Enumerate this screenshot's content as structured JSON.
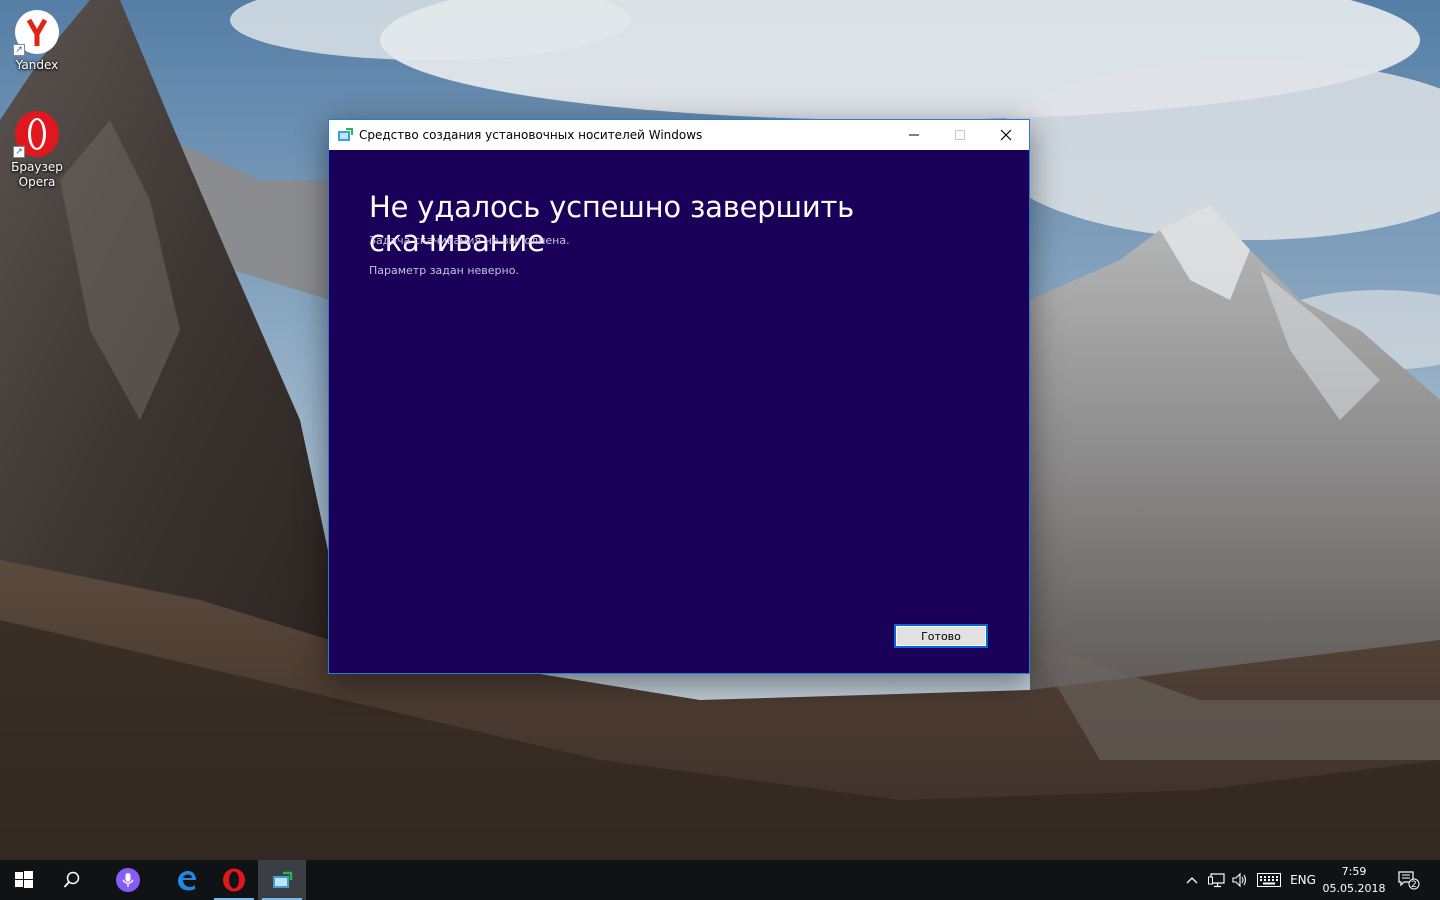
{
  "desktop": {
    "icons": [
      {
        "label": "Yandex",
        "icon": "yandex-browser-icon"
      },
      {
        "label": "Браузер Opera",
        "icon": "opera-browser-icon"
      }
    ]
  },
  "window": {
    "title": "Средство создания установочных носителей Windows",
    "heading": "Не удалось успешно завершить скачивание",
    "message_1": "Задача скачивания не выполнена.",
    "message_2": "Параметр задан неверно.",
    "done_button": "Готово",
    "background_color": "#1a0058"
  },
  "taskbar": {
    "pinned": [
      {
        "name": "start",
        "icon": "windows-start-icon"
      },
      {
        "name": "search",
        "icon": "search-icon"
      },
      {
        "name": "cortana",
        "icon": "cortana-microphone-icon"
      },
      {
        "name": "edge",
        "icon": "edge-icon"
      },
      {
        "name": "opera",
        "icon": "opera-icon"
      },
      {
        "name": "media-creation-tool",
        "icon": "media-creation-tool-icon",
        "active": true
      }
    ],
    "tray": {
      "language": "ENG",
      "time": "7:59",
      "date": "05.05.2018",
      "notifications_count": "2"
    }
  }
}
